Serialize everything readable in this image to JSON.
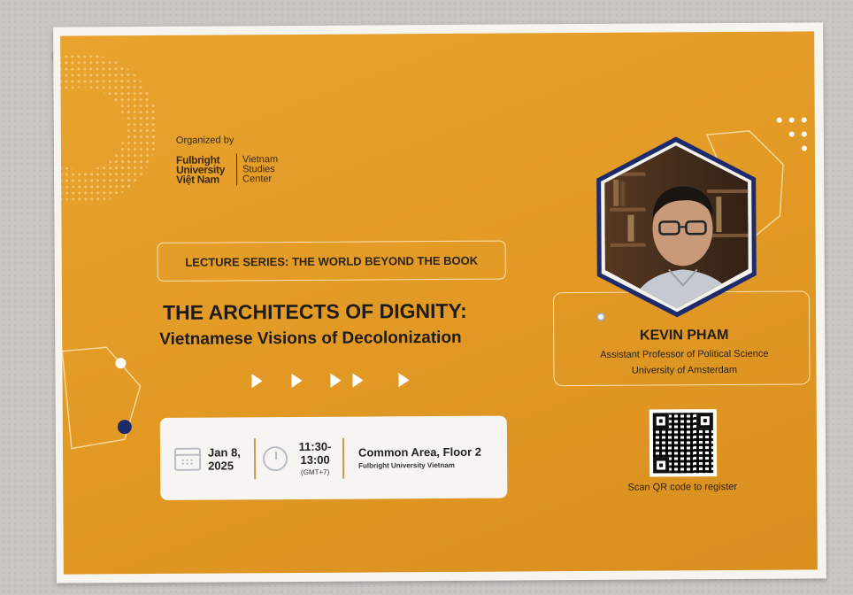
{
  "organizer": {
    "label": "Organized by",
    "university_line1": "Fulbright",
    "university_line2": "University",
    "university_line3": "Việt Nam",
    "center_line1": "Vietnam",
    "center_line2": "Studies",
    "center_line3": "Center"
  },
  "series": "LECTURE SERIES: THE WORLD BEYOND THE BOOK",
  "title": "THE ARCHITECTS OF DIGNITY:",
  "subtitle": "Vietnamese Visions of Decolonization",
  "event": {
    "date_line1": "Jan 8,",
    "date_line2": "2025",
    "time_line1": "11:30-",
    "time_line2": "13:00",
    "timezone": "(GMT+7)",
    "venue": "Common Area, Floor 2",
    "venue_sub": "Fulbright University Vietnam"
  },
  "speaker": {
    "name": "KEVIN PHAM",
    "role": "Assistant Professor of Political Science",
    "affiliation": "University of Amsterdam"
  },
  "register": {
    "caption": "Scan QR code to register"
  },
  "colors": {
    "poster_orange": "#e29a25",
    "navy": "#1d2a6b",
    "card": "#f6f5f2"
  }
}
